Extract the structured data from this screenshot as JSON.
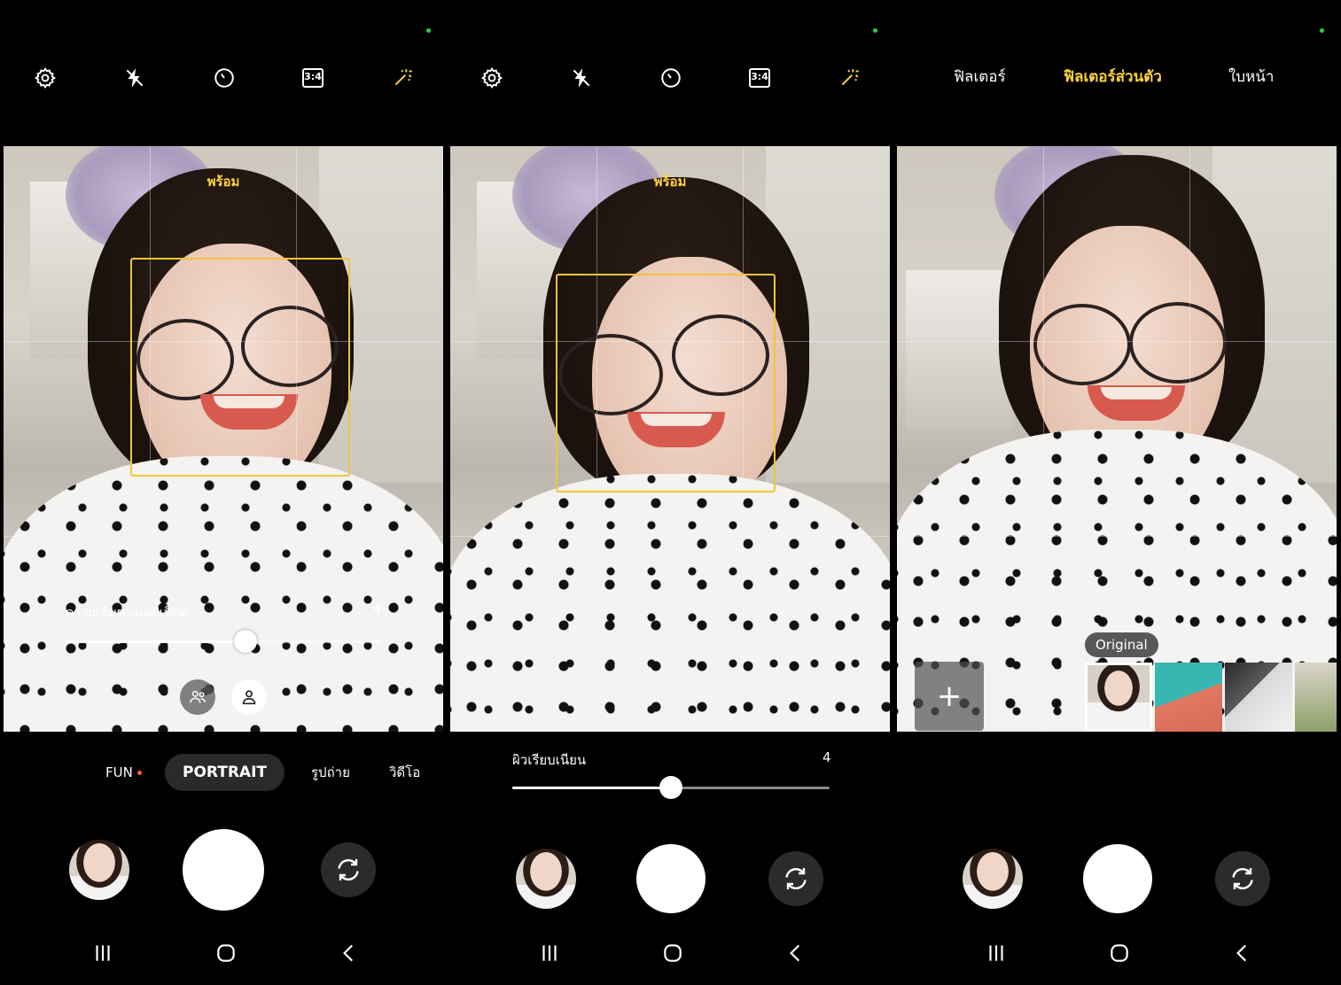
{
  "status": {
    "indicator_color": "#2bd24c"
  },
  "panels": [
    {
      "toolbar": {
        "ratio": "3:4"
      },
      "ready_text": "พร้อม",
      "effect": {
        "label": "ความเข้มของเอฟเฟ็กต์",
        "value": "4",
        "level": 0.57
      },
      "modes": {
        "fun": "FUN",
        "portrait": "PORTRAIT",
        "photo": "รูปถ่าย",
        "video": "วิดีโอ"
      }
    },
    {
      "toolbar": {
        "ratio": "3:4"
      },
      "ready_text": "พร้อม",
      "smooth": {
        "label": "ผิวเรียบเนียน",
        "value": "4",
        "level": 0.5
      }
    },
    {
      "filter_tabs": {
        "filters": "ฟิลเตอร์",
        "my_filters": "ฟิลเตอร์ส่วนตัว",
        "face": "ใบหน้า"
      },
      "original_label": "Original",
      "add_label": "+"
    }
  ],
  "colors": {
    "accent_yellow": "#ffd23c",
    "face_box": "#f2c43a",
    "mode_active_bg": "#2a2a2a",
    "fun_dot": "#ff5a3c"
  },
  "icons": {
    "settings": "gear-icon",
    "flash": "flash-off-icon",
    "timer": "timer-icon",
    "ratio": "aspect-ratio-icon",
    "effects": "magic-wand-icon",
    "flip": "switch-camera-icon",
    "group": "group-portrait-icon",
    "single": "single-portrait-icon",
    "nav_recent": "recent-apps-icon",
    "nav_home": "home-icon",
    "nav_back": "back-icon"
  }
}
